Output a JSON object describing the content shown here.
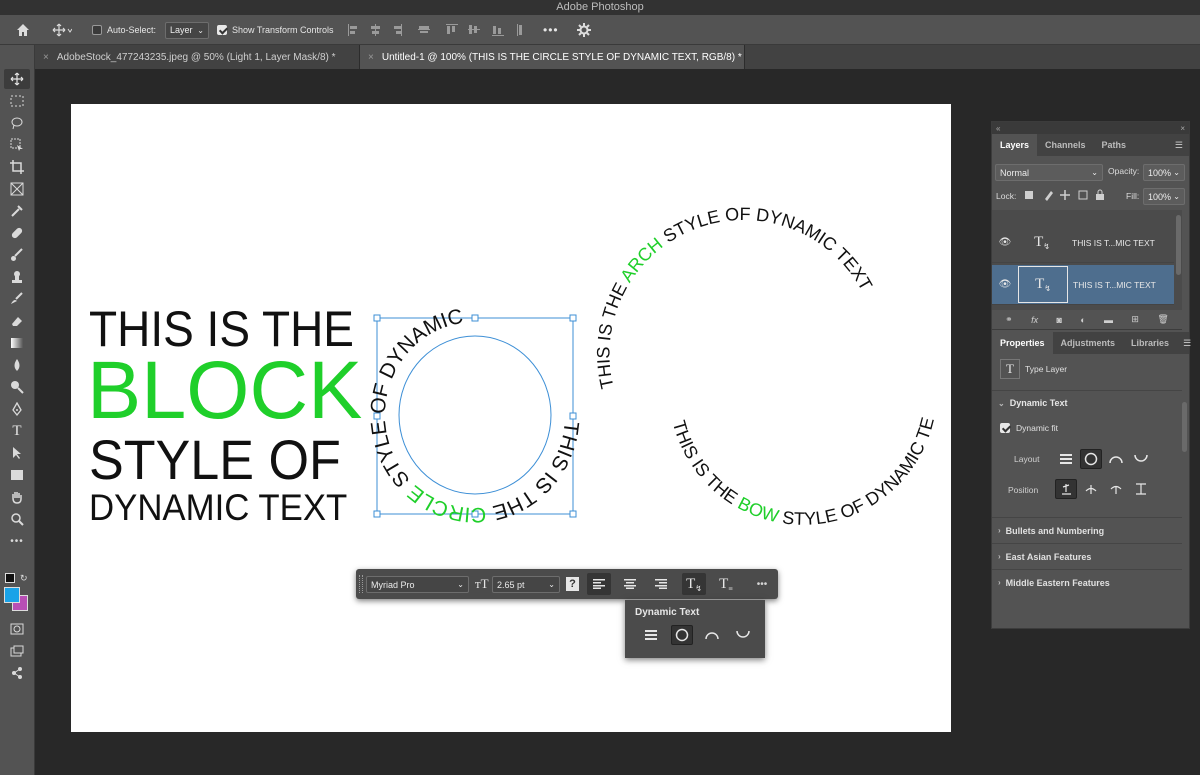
{
  "app": {
    "title": "Adobe Photoshop"
  },
  "options_bar": {
    "auto_select_label": "Auto-Select:",
    "auto_select_value": "Layer",
    "transform_label": "Show Transform Controls",
    "more_label": "•••"
  },
  "document_tabs": [
    {
      "label": "AdobeStock_477243235.jpeg @ 50% (Light 1, Layer Mask/8) *",
      "active": false
    },
    {
      "label": "Untitled-1 @ 100% (THIS IS THE CIRCLE STYLE OF DYNAMIC TEXT, RGB/8) *",
      "active": true
    }
  ],
  "canvas": {
    "block_text": {
      "line1": "THIS IS THE",
      "line2": "BLOCK",
      "line3": "STYLE OF",
      "line4": "DYNAMIC TEXT"
    },
    "circle_text": {
      "pre": "THIS IS THE ",
      "accent": "CIRCLE",
      "post": " STYLE OF DYNAMIC TEXT"
    },
    "arch_text": {
      "pre": "THIS IS THE ",
      "accent": "ARCH",
      "post": " STYLE OF DYNAMIC TEXT"
    },
    "bow_text": {
      "pre": "THIS IS THE ",
      "accent": "BOW",
      "post": " STYLE OF DYNAMIC TEXT"
    },
    "accent_color": "#1fcf2a",
    "text_color": "#111111"
  },
  "contextual_bar": {
    "font": "Myriad Pro",
    "size": "2.65 pt",
    "more_label": "•••"
  },
  "dynamic_popup": {
    "title": "Dynamic Text"
  },
  "layers_panel": {
    "tabs": [
      "Layers",
      "Channels",
      "Paths"
    ],
    "blend_mode": "Normal",
    "opacity_label": "Opacity:",
    "opacity_value": "100%",
    "lock_label": "Lock:",
    "fill_label": "Fill:",
    "fill_value": "100%",
    "layers": [
      {
        "name": "THIS IS T...MIC TEXT",
        "selected": false
      },
      {
        "name": "THIS IS T...MIC TEXT",
        "selected": true
      }
    ]
  },
  "properties_panel": {
    "tabs": [
      "Properties",
      "Adjustments",
      "Libraries"
    ],
    "type_layer_label": "Type Layer",
    "section_title": "Dynamic Text",
    "dynamic_fit_label": "Dynamic fit",
    "layout_label": "Layout",
    "position_label": "Position",
    "collapsed_sections": [
      "Bullets and Numbering",
      "East Asian Features",
      "Middle Eastern Features"
    ]
  },
  "colors": {
    "foreground": "#1aa3e8",
    "background": "#b84fb5",
    "selected_layer": "#4e6e8e"
  }
}
